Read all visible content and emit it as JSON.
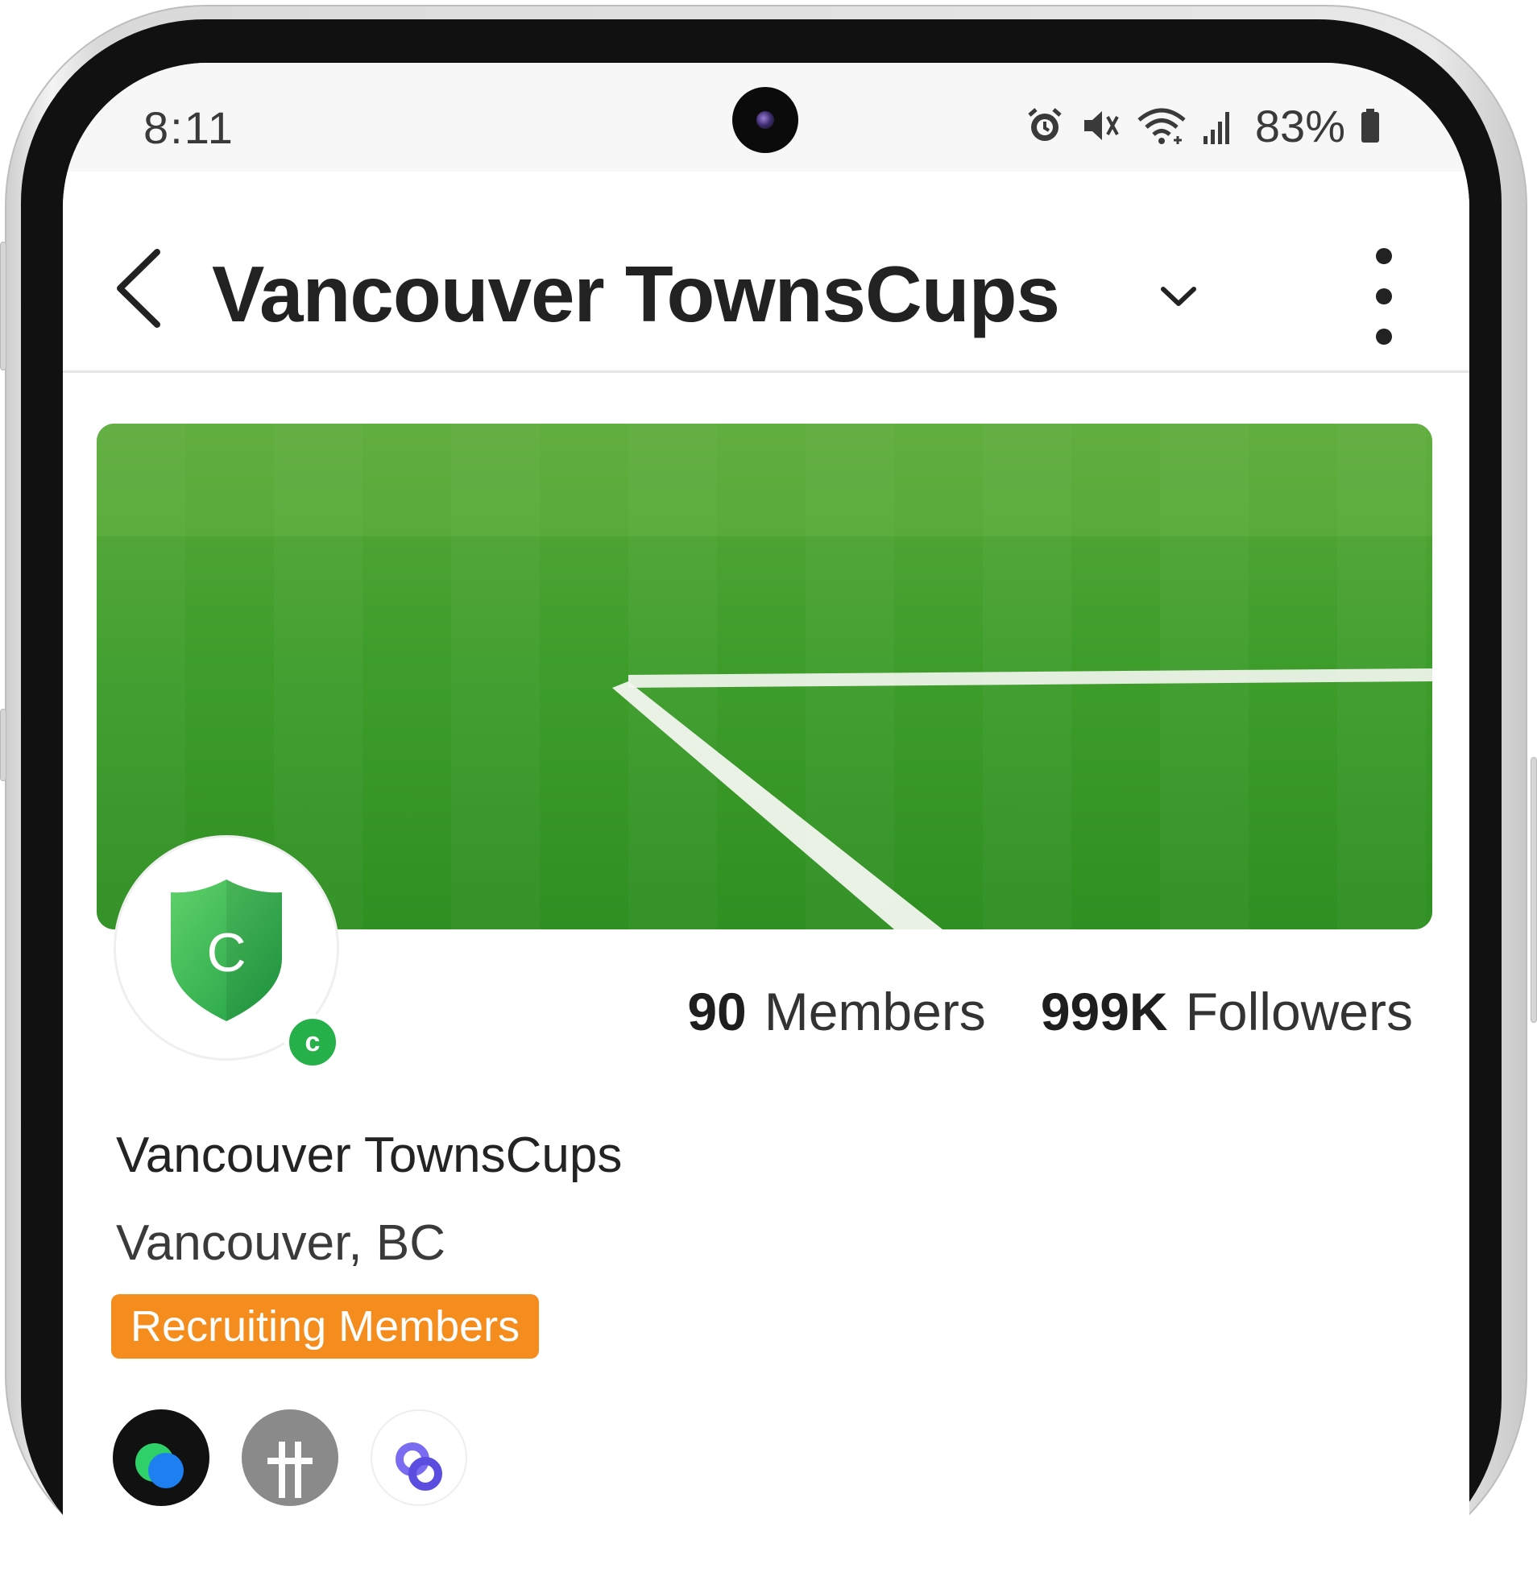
{
  "status_bar": {
    "time": "8:11",
    "battery": "83%",
    "icons": [
      "alarm-icon",
      "mute-icon",
      "wifi-icon",
      "signal-icon",
      "battery-icon"
    ]
  },
  "app_bar": {
    "title": "Vancouver TownsCups",
    "icons": [
      "back-icon",
      "chevron-down-icon",
      "more-vert-icon"
    ]
  },
  "club": {
    "avatar_letter": "C",
    "badge_letter": "c",
    "members_count": "90",
    "members_label": "Members",
    "followers_count": "999K",
    "followers_label": "Followers",
    "name": "Vancouver TownsCups",
    "location": "Vancouver, BC",
    "badge": "Recruiting Members"
  },
  "colors": {
    "brand_green": "#26b04a",
    "recruit_orange": "#f58c1e",
    "grass": "#3f9a2a"
  }
}
